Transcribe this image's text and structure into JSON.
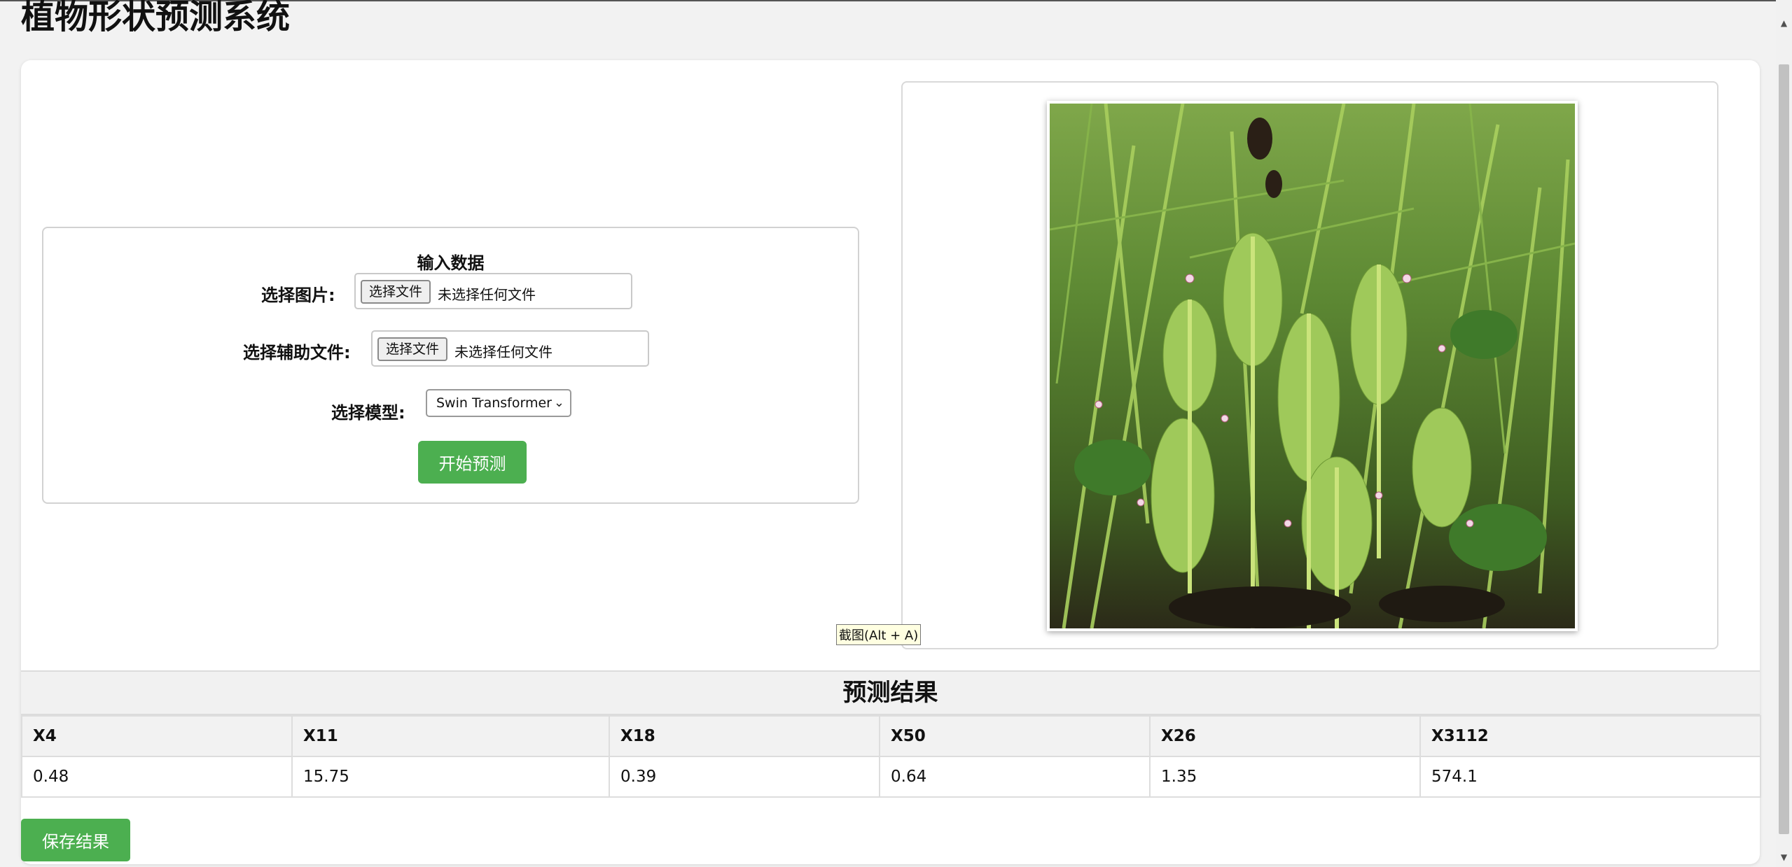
{
  "page": {
    "title": "植物形状预测系统"
  },
  "form": {
    "heading": "输入数据",
    "image_label": "选择图片:",
    "image_button": "选择文件",
    "image_status": "未选择任何文件",
    "aux_label": "选择辅助文件:",
    "aux_button": "选择文件",
    "aux_status": "未选择任何文件",
    "model_label": "选择模型:",
    "model_selected": "Swin Transformer",
    "predict_button": "开始预测"
  },
  "image_preview": {
    "icon": "plant-photo",
    "tooltip": "截图(Alt + A)"
  },
  "results": {
    "heading": "预测结果",
    "columns": [
      "X4",
      "X11",
      "X18",
      "X50",
      "X26",
      "X3112"
    ],
    "values": [
      "0.48",
      "15.75",
      "0.39",
      "0.64",
      "1.35",
      "574.1"
    ],
    "save_button": "保存结果"
  },
  "colors": {
    "accent": "#4caf50",
    "page_bg": "#f2f2f2",
    "table_head_bg": "#f2f2f2"
  }
}
